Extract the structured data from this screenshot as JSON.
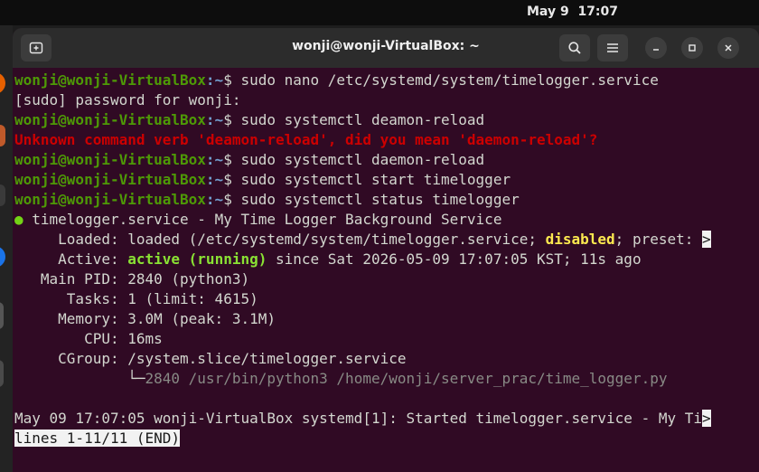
{
  "topbar": {
    "clock": "May 9  17:07"
  },
  "window": {
    "title": "wonji@wonji-VirtualBox: ~"
  },
  "terminal": {
    "prompt_user": "wonji@wonji-VirtualBox",
    "prompt_path": ":~",
    "prompt_sym": "$",
    "lines": {
      "cmd1": " sudo nano /etc/systemd/system/timelogger.service",
      "sudo_pw": "[sudo] password for wonji:",
      "cmd2": " sudo systemctl deamon-reload",
      "err": "Unknown command verb 'deamon-reload', did you mean 'daemon-reload'?",
      "cmd3": " sudo systemctl daemon-reload",
      "cmd4": " sudo systemctl start timelogger",
      "cmd5": " sudo systemctl status timelogger",
      "svc_dot": "●",
      "svc_head": " timelogger.service - My Time Logger Background Service",
      "loaded_a": "     Loaded: loaded (/etc/systemd/system/timelogger.service; ",
      "loaded_disabled": "disabled",
      "loaded_b": "; preset: ",
      "loaded_trunc": ">",
      "active_a": "     Active: ",
      "active_state": "active (running)",
      "active_b": " since Sat 2026-05-09 17:07:05 KST; 11s ago",
      "mainpid": "   Main PID: 2840 (python3)",
      "tasks": "      Tasks: 1 (limit: 4615)",
      "memory": "     Memory: 3.0M (peak: 3.1M)",
      "cpu": "        CPU: 16ms",
      "cgroup": "     CGroup: /system.slice/timelogger.service",
      "proc_tree": "             └─",
      "proc": "2840 /usr/bin/python3 /home/wonji/server_prac/time_logger.py",
      "blank": " ",
      "log": "May 09 17:07:05 wonji-VirtualBox systemd[1]: Started timelogger.service - My Ti",
      "log_trunc": ">",
      "pager": "lines 1-11/11 (END)"
    }
  }
}
